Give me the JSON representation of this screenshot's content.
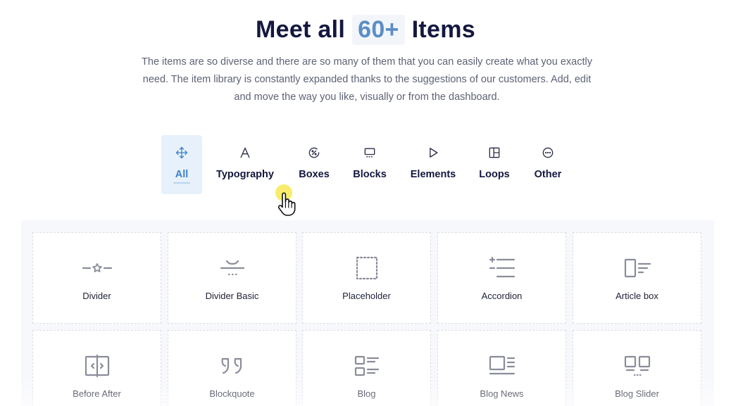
{
  "hero": {
    "title_before": "Meet all",
    "title_count": "60+",
    "title_after": "Items",
    "description": "The items are so diverse and there are so many of them that you can easily create what you exactly need. The item library is constantly expanded thanks to the suggestions of our customers. Add, edit and move the way you like, visually or from the dashboard."
  },
  "tabs": [
    {
      "label": "All",
      "icon": "move-icon",
      "active": true
    },
    {
      "label": "Typography",
      "icon": "letter-a-icon",
      "active": false
    },
    {
      "label": "Boxes",
      "icon": "percent-circle-icon",
      "active": false
    },
    {
      "label": "Blocks",
      "icon": "blocks-icon",
      "active": false
    },
    {
      "label": "Elements",
      "icon": "play-icon",
      "active": false
    },
    {
      "label": "Loops",
      "icon": "layout-icon",
      "active": false
    },
    {
      "label": "Other",
      "icon": "more-circle-icon",
      "active": false
    }
  ],
  "items": [
    {
      "label": "Divider",
      "icon": "divider-icon"
    },
    {
      "label": "Divider Basic",
      "icon": "divider-basic-icon"
    },
    {
      "label": "Placeholder",
      "icon": "placeholder-icon"
    },
    {
      "label": "Accordion",
      "icon": "accordion-icon"
    },
    {
      "label": "Article box",
      "icon": "article-box-icon"
    },
    {
      "label": "Before After",
      "icon": "before-after-icon"
    },
    {
      "label": "Blockquote",
      "icon": "blockquote-icon"
    },
    {
      "label": "Blog",
      "icon": "blog-icon"
    },
    {
      "label": "Blog News",
      "icon": "blog-news-icon"
    },
    {
      "label": "Blog Slider",
      "icon": "blog-slider-icon"
    }
  ],
  "colors": {
    "heading": "#14173f",
    "accent": "#5b8ec6",
    "active_tab_bg": "#e7f1fb",
    "active_tab_text": "#3c82c6",
    "icon_gray": "#8a8d99"
  }
}
